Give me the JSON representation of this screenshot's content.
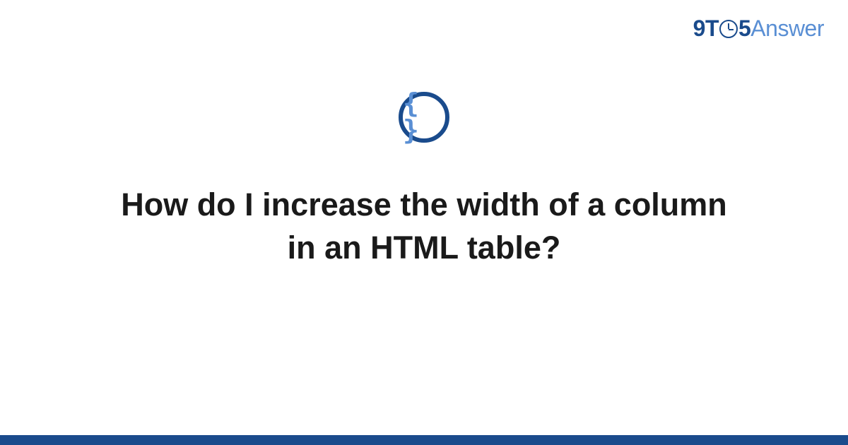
{
  "logo": {
    "part1": "9T",
    "part2": "5",
    "part3": "Answer"
  },
  "icon": {
    "braces": "{ }"
  },
  "question": {
    "title": "How do I increase the width of a column in an HTML table?"
  }
}
